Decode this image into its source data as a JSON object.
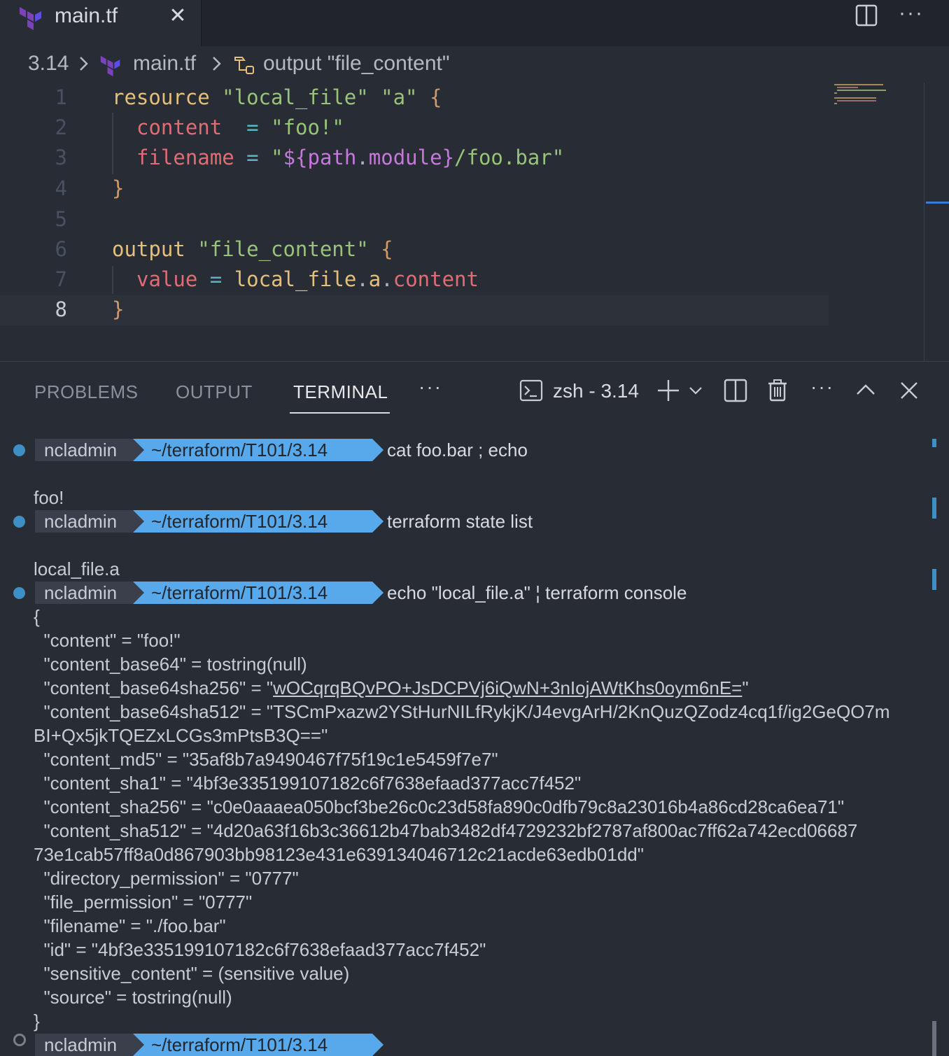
{
  "tab": {
    "label": "main.tf"
  },
  "breadcrumb": {
    "folder": "3.14",
    "file": "main.tf",
    "symbol": "output \"file_content\""
  },
  "editor": {
    "line_numbers": [
      "1",
      "2",
      "3",
      "4",
      "5",
      "6",
      "7",
      "8"
    ],
    "lines": {
      "l1": {
        "kw": "resource",
        "s1": "\"local_file\"",
        "s2": "\"a\"",
        "brace": "{"
      },
      "l2": {
        "prop": "content",
        "op": "=",
        "str": "\"foo!\""
      },
      "l3": {
        "prop": "filename",
        "op": "=",
        "q1": "\"",
        "int_open": "${",
        "path": "path",
        "dot": ".",
        "module": "module",
        "int_close": "}",
        "rest": "/foo.bar\""
      },
      "l4": {
        "brace": "}"
      },
      "l6": {
        "kw": "output",
        "s1": "\"file_content\"",
        "brace": "{"
      },
      "l7": {
        "prop": "value",
        "op": "=",
        "a": "local_file",
        "d1": ".",
        "b": "a",
        "d2": ".",
        "c": "content"
      },
      "l8": {
        "brace": "}"
      }
    }
  },
  "panel": {
    "tabs": [
      "PROBLEMS",
      "OUTPUT",
      "TERMINAL"
    ],
    "more": "···",
    "shell": "zsh - 3.14"
  },
  "terminal": {
    "user": "ncladmin",
    "path": "~/terraform/T101/3.14",
    "cmd1": "cat foo.bar ; echo",
    "out1": "foo!",
    "cmd2": "terraform state list",
    "out2": "local_file.a",
    "cmd3": "echo \"local_file.a\" ¦ terraform console",
    "out3": [
      "{",
      "  \"content\" = \"foo!\"",
      "  \"content_base64\" = tostring(null)",
      "  \"content_base64sha256\" = \"",
      "wOCqrqBQvPO+JsDCPVj6iQwN+3nIojAWtKhs0oym6nE=",
      "\"",
      "  \"content_base64sha512\" = \"TSCmPxazw2YStHurNILfRykjK/J4evgArH/2KnQuzQZodz4cq1f/ig2GeQO7m",
      "BI+Qx5jkTQEZxLCGs3mPtsB3Q==\"",
      "  \"content_md5\" = \"35af8b7a9490467f75f19c1e5459f7e7\"",
      "  \"content_sha1\" = \"4bf3e335199107182c6f7638efaad377acc7f452\"",
      "  \"content_sha256\" = \"c0e0aaaea050bcf3be26c0c23d58fa890c0dfb79c8a23016b4a86cd28ca6ea71\"",
      "  \"content_sha512\" = \"4d20a63f16b3c36612b47bab3482df4729232bf2787af800ac7ff62a742ecd06687",
      "73e1cab57ff8a0d867903bb98123e431e639134046712c21acde63edb01dd\"",
      "  \"directory_permission\" = \"0777\"",
      "  \"file_permission\" = \"0777\"",
      "  \"filename\" = \"./foo.bar\"",
      "  \"id\" = \"4bf3e335199107182c6f7638efaad377acc7f452\"",
      "  \"sensitive_content\" = (sensitive value)",
      "  \"source\" = tostring(null)",
      "}"
    ]
  },
  "colors": {
    "background": "#282c34",
    "keyword": "#e5c07b",
    "string": "#98c379",
    "property": "#e06c75",
    "prompt_path": "#58a8ec",
    "terraform_purple": "#7b42bc"
  }
}
